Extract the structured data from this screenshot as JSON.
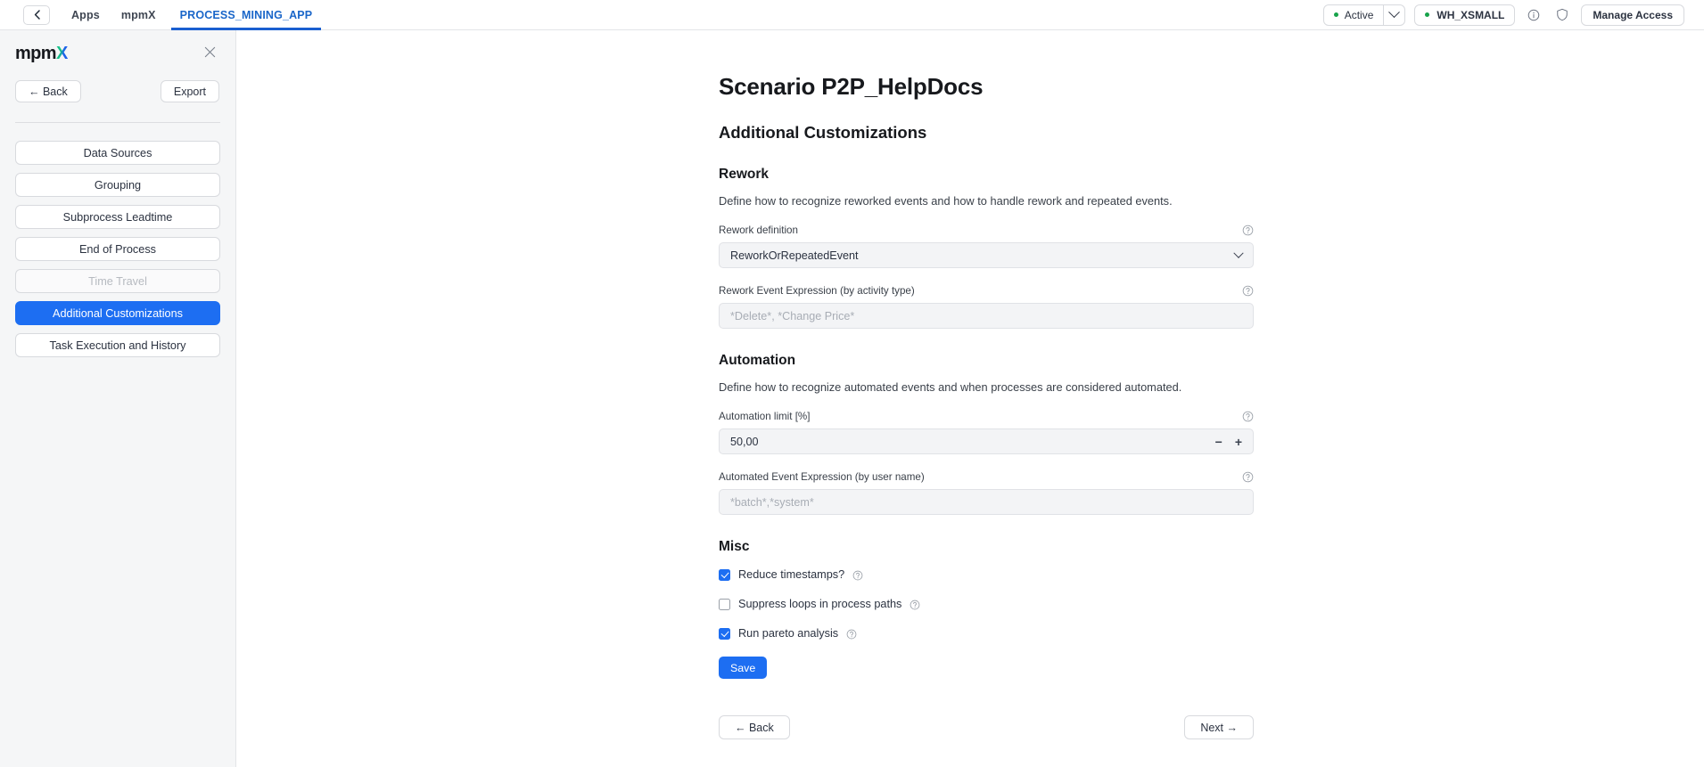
{
  "topbar": {
    "back_icon": "chevron-left-icon",
    "breadcrumbs": [
      {
        "label": "Apps",
        "active": false
      },
      {
        "label": "mpmX",
        "active": false
      },
      {
        "label": "PROCESS_MINING_APP",
        "active": true
      }
    ],
    "status": {
      "label": "Active",
      "dot_color": "#17a34a",
      "chevron_icon": "chevron-down-icon"
    },
    "warehouse": {
      "label": "WH_XSMALL",
      "dot_color": "#17a34a"
    },
    "info_icon": "info-circle-icon",
    "shield_icon": "shield-icon",
    "manage_access_label": "Manage Access"
  },
  "sidebar": {
    "logo": {
      "part1": "mpm",
      "part2": "X"
    },
    "close_icon": "close-icon",
    "back_label": "← Back",
    "export_label": "Export",
    "items": [
      {
        "label": "Data Sources",
        "state": "normal"
      },
      {
        "label": "Grouping",
        "state": "normal"
      },
      {
        "label": "Subprocess Leadtime",
        "state": "normal"
      },
      {
        "label": "End of Process",
        "state": "normal"
      },
      {
        "label": "Time Travel",
        "state": "disabled"
      },
      {
        "label": "Additional Customizations",
        "state": "selected"
      },
      {
        "label": "Task Execution and History",
        "state": "normal"
      }
    ]
  },
  "main": {
    "page_title": "Scenario P2P_HelpDocs",
    "page_subtitle": "Additional Customizations",
    "sections": {
      "rework": {
        "heading": "Rework",
        "description": "Define how to recognize reworked events and how to handle rework and repeated events.",
        "definition": {
          "label": "Rework definition",
          "value": "ReworkOrRepeatedEvent",
          "help_icon": "help-circle-icon",
          "chevron_icon": "chevron-down-icon"
        },
        "expression": {
          "label": "Rework Event Expression (by activity type)",
          "value": "",
          "placeholder": "*Delete*, *Change Price*",
          "help_icon": "help-circle-icon"
        }
      },
      "automation": {
        "heading": "Automation",
        "description": "Define how to recognize automated events and when processes are considered automated.",
        "limit": {
          "label": "Automation limit [%]",
          "value": "50,00",
          "minus_label": "−",
          "plus_label": "+",
          "help_icon": "help-circle-icon"
        },
        "expression": {
          "label": "Automated Event Expression (by user name)",
          "value": "",
          "placeholder": "*batch*,*system*",
          "help_icon": "help-circle-icon"
        }
      },
      "misc": {
        "heading": "Misc",
        "checkboxes": [
          {
            "label": "Reduce timestamps?",
            "checked": true,
            "help_icon": "help-circle-icon"
          },
          {
            "label": "Suppress loops in process paths",
            "checked": false,
            "help_icon": "help-circle-icon"
          },
          {
            "label": "Run pareto analysis",
            "checked": true,
            "help_icon": "help-circle-icon"
          }
        ],
        "save_label": "Save"
      }
    },
    "footer": {
      "back_label": "← Back",
      "next_label": "Next →"
    }
  },
  "colors": {
    "accent": "#1d6ef2",
    "tab_active": "#1a66c9",
    "status_green": "#17a34a",
    "sidebar_bg": "#f5f6f7"
  }
}
